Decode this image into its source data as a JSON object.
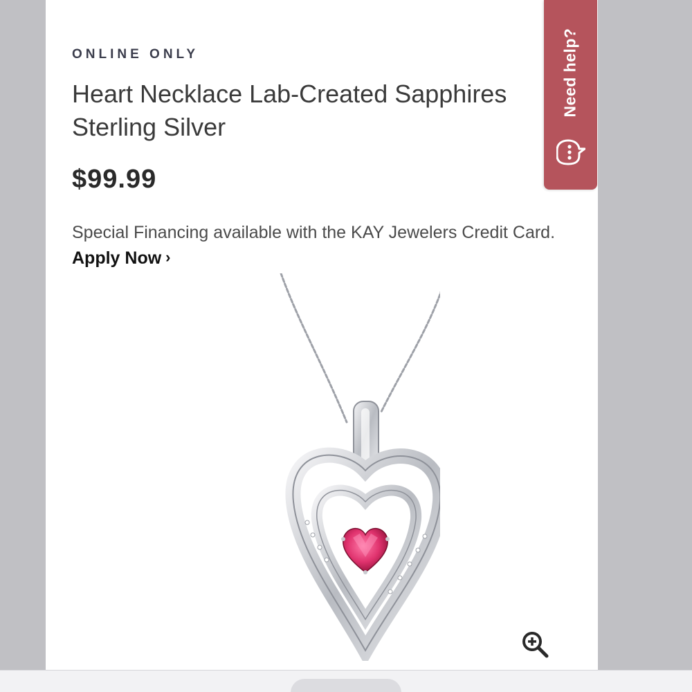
{
  "product": {
    "badge": "ONLINE ONLY",
    "title": "Heart Necklace Lab-Created Sapphires Sterling Silver",
    "price": "$99.99",
    "financing_text": "Special Financing available with the KAY Jewelers Credit Card.",
    "apply_label": "Apply Now",
    "apply_chevron": "›"
  },
  "help": {
    "label": "Need help?",
    "icon": "chat-bubble-icon"
  },
  "image": {
    "alt": "Heart pendant necklace with pink heart-shaped stone",
    "zoom_icon": "zoom-in-icon"
  },
  "colors": {
    "help_tab": "#b5545c",
    "stone": "#e0336e",
    "text_dark": "#2a2a2a",
    "background": "#c0c0c4"
  }
}
